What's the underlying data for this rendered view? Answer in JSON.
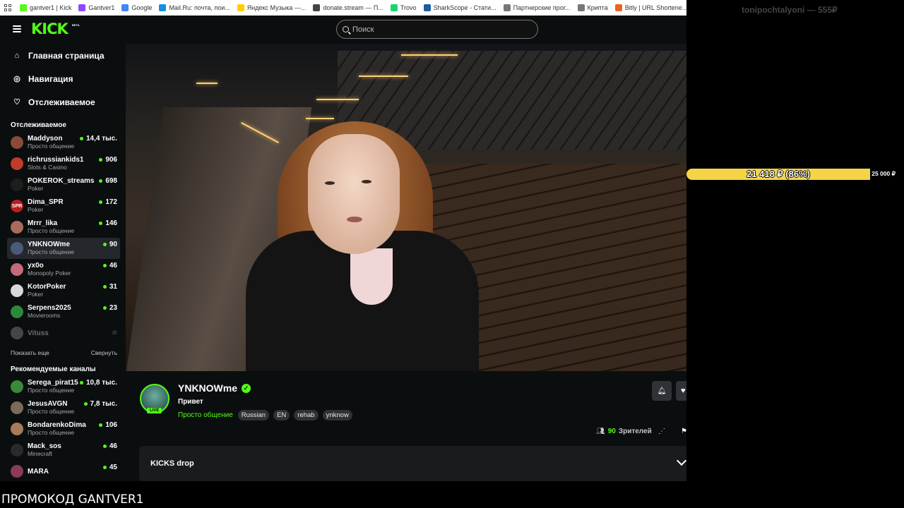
{
  "bookmarks": [
    {
      "label": "gantver1 | Kick",
      "color": "#53fc18"
    },
    {
      "label": "Gantver1",
      "color": "#9146ff"
    },
    {
      "label": "Google",
      "color": "#4285f4"
    },
    {
      "label": "Mail.Ru: почта, пои...",
      "color": "#168de2"
    },
    {
      "label": "Яндекс Музыка —...",
      "color": "#ffcc00"
    },
    {
      "label": "donate.stream — П...",
      "color": "#444444"
    },
    {
      "label": "Trovo",
      "color": "#19d66b"
    },
    {
      "label": "SharkScope - Стати...",
      "color": "#1b5e9b"
    },
    {
      "label": "Партнерские прог...",
      "color": "#777777"
    },
    {
      "label": "Крипта",
      "color": "#777777"
    },
    {
      "label": "Bitly | URL Shortene...",
      "color": "#ee6123"
    }
  ],
  "header": {
    "logo": "KICK",
    "beta": "BETA",
    "search_placeholder": "Поиск"
  },
  "nav": [
    {
      "label": "Главная страница",
      "icon": "home-icon"
    },
    {
      "label": "Навигация",
      "icon": "compass-icon"
    },
    {
      "label": "Отслеживаемое",
      "icon": "heart-icon"
    }
  ],
  "following": {
    "title": "Отслеживаемое",
    "channels": [
      {
        "name": "Maddyson",
        "category": "Просто общение",
        "viewers": "14,4 тыс.",
        "avatar_color": "#8a4a3a"
      },
      {
        "name": "richrussiankids1",
        "category": "Slots & Casino",
        "viewers": "906",
        "avatar_color": "#c23a2a"
      },
      {
        "name": "POKEROK_streams",
        "category": "Poker",
        "viewers": "698",
        "avatar_color": "#1e1e1e"
      },
      {
        "name": "Dima_SPR",
        "category": "Poker",
        "viewers": "172",
        "avatar_color": "#b81e1e",
        "avatar_text": "SPR"
      },
      {
        "name": "Mrrr_lika",
        "category": "Просто общение",
        "viewers": "146",
        "avatar_color": "#a86a5a"
      },
      {
        "name": "YNKNOWme",
        "category": "Просто общение",
        "viewers": "90",
        "avatar_color": "#4a5a7a",
        "active": true
      },
      {
        "name": "yx0o",
        "category": "Monopoly Poker",
        "viewers": "46",
        "avatar_color": "#c46a7a"
      },
      {
        "name": "KotorPoker",
        "category": "Poker",
        "viewers": "31",
        "avatar_color": "#d8d8d8"
      },
      {
        "name": "Serpens2025",
        "category": "Movierooms",
        "viewers": "23",
        "avatar_color": "#2a8a3a"
      },
      {
        "name": "Vituss",
        "category": "",
        "viewers": "",
        "avatar_color": "#9a9a9a",
        "offline": true
      }
    ],
    "show_more": "Показать еще",
    "collapse": "Свернуть"
  },
  "recommended": {
    "title": "Рекомендуемые каналы",
    "channels": [
      {
        "name": "Serega_pirat15",
        "category": "Просто общение",
        "viewers": "10,8 тыс.",
        "avatar_color": "#3a8a3a"
      },
      {
        "name": "JesusAVGN",
        "category": "Просто общение",
        "viewers": "7,8 тыс.",
        "avatar_color": "#7a6a5a"
      },
      {
        "name": "BondarenkoDima",
        "category": "Просто общение",
        "viewers": "106",
        "avatar_color": "#a87a5a"
      },
      {
        "name": "Mack_sos",
        "category": "Minecraft",
        "viewers": "46",
        "avatar_color": "#2a2a2a"
      },
      {
        "name": "MARA",
        "category": "",
        "viewers": "45",
        "avatar_color": "#8a3a5a"
      }
    ]
  },
  "stream": {
    "channel": "YNKNOWme",
    "live_badge": "LIVE",
    "title": "Привет",
    "category": "Просто общение",
    "tags": [
      "Russian",
      "EN",
      "rehab",
      "ynknow"
    ],
    "viewers": "90",
    "viewers_label": "Зрителей",
    "drops_label": "KICKS drop"
  },
  "overlay": {
    "donor": "tonipochtalyoni — 555₽",
    "goal_text": "21 418 ₽ (86%)",
    "goal_progress": 0.86,
    "goal_target": "25 000 ₽",
    "goal_color": "#f5d547",
    "promo": "ПРОМОКОД GANTVER1"
  },
  "colors": {
    "accent": "#53fc18",
    "background": "#0b0e0f"
  }
}
